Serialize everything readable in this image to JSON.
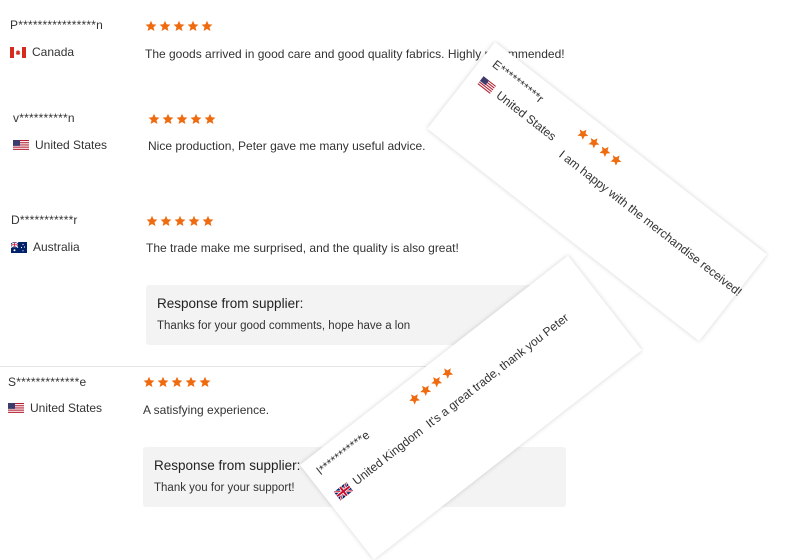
{
  "reviews": [
    {
      "name": "P****************n",
      "country": "Canada",
      "flag_icon": "canada-flag-icon",
      "rating": 5,
      "comment": "The goods arrived in good care and good quality fabrics. Highly recommended!"
    },
    {
      "name": "v**********n",
      "country": "United States",
      "flag_icon": "usa-flag-icon",
      "rating": 5,
      "comment": "Nice production, Peter gave me many useful advice."
    },
    {
      "name": "D***********r",
      "country": "Australia",
      "flag_icon": "australia-flag-icon",
      "rating": 5,
      "comment": "The trade make me surprised, and the quality is also great!",
      "response_title": "Response from supplier:",
      "response_text": "Thanks for your good comments, hope have a lon"
    },
    {
      "name": "S*************e",
      "country": "United States",
      "flag_icon": "usa-flag-icon",
      "rating": 5,
      "comment": "A satisfying experience.",
      "response_title": "Response from supplier:",
      "response_text": "Thank you for your support!"
    }
  ],
  "overlay_reviews": [
    {
      "name": "E**********r",
      "country": "United States",
      "flag_icon": "usa-flag-icon",
      "rating": 4,
      "comment": "I am happy with the merchandise received!"
    },
    {
      "name": "l***********e",
      "country": "United Kingdom",
      "flag_icon": "uk-flag-icon",
      "rating": 4,
      "comment": "It's a great trade, thank you Peter"
    }
  ],
  "colors": {
    "star": "#ef6b10",
    "response_bg": "#f3f3f3"
  }
}
